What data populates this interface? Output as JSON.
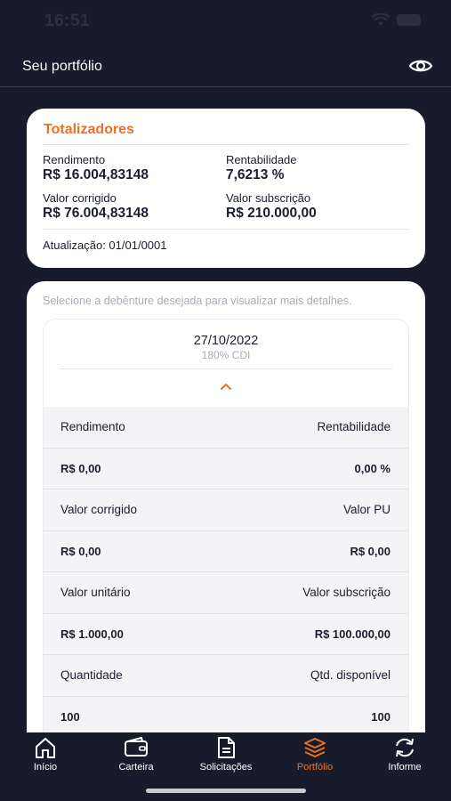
{
  "status_bar": {
    "time": "16:51"
  },
  "nav": {
    "title": "Seu portfólio",
    "eye_icon": "eye-icon"
  },
  "totals": {
    "title": "Totalizadores",
    "rendimento_label": "Rendimento",
    "rendimento_value": "R$ 16.004,83148",
    "rentabilidade_label": "Rentabilidade",
    "rentabilidade_value": "7,6213 %",
    "valor_corrigido_label": "Valor corrigido",
    "valor_corrigido_value": "R$ 76.004,83148",
    "valor_subscricao_label": "Valor subscrição",
    "valor_subscricao_value": "R$ 210.000,00",
    "atualizacao": "Atualização: 01/01/0001"
  },
  "list": {
    "hint": "Selecione a debênture desejada para visualizar mais detalhes.",
    "debenture": {
      "date": "27/10/2022",
      "rate": "180% CDI",
      "rows": [
        {
          "left": "Rendimento",
          "right": "Rentabilidade"
        },
        {
          "left": "R$ 0,00",
          "right": "0,00 %"
        },
        {
          "left": "Valor corrigido",
          "right": "Valor PU"
        },
        {
          "left": "R$ 0,00",
          "right": "R$ 0,00"
        },
        {
          "left": "Valor unitário",
          "right": "Valor subscrição"
        },
        {
          "left": "R$ 1.000,00",
          "right": "R$ 100.000,00"
        },
        {
          "left": "Quantidade",
          "right": "Qtd. disponível"
        },
        {
          "left": "100",
          "right": "100"
        }
      ]
    }
  },
  "tabs": [
    {
      "label": "Início",
      "icon": "home-icon",
      "active": false
    },
    {
      "label": "Carteira",
      "icon": "wallet-icon",
      "active": false
    },
    {
      "label": "Solicitações",
      "icon": "document-icon",
      "active": false
    },
    {
      "label": "Portfólio",
      "icon": "layers-icon",
      "active": true
    },
    {
      "label": "Informe",
      "icon": "refresh-icon",
      "active": false
    }
  ],
  "colors": {
    "accent": "#ee7024",
    "background": "#181b2c",
    "card": "#ffffff"
  }
}
